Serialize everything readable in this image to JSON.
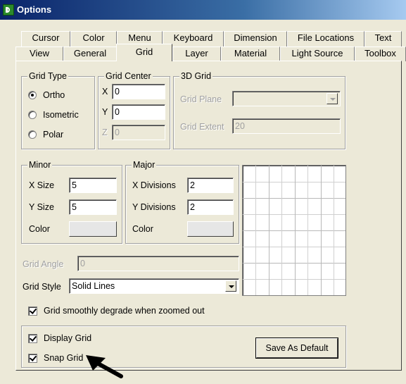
{
  "window": {
    "title": "Options"
  },
  "tabs": {
    "row_back": [
      "Cursor",
      "Color",
      "Menu",
      "Keyboard",
      "Dimension",
      "File Locations",
      "Text"
    ],
    "row_front": [
      "View",
      "General",
      "Grid",
      "Layer",
      "Material",
      "Light Source",
      "Toolbox"
    ],
    "active": "Grid"
  },
  "grid_type": {
    "legend": "Grid Type",
    "options": [
      "Ortho",
      "Isometric",
      "Polar"
    ],
    "selected": "Ortho"
  },
  "grid_center": {
    "legend": "Grid Center",
    "x_label": "X",
    "x_value": "0",
    "y_label": "Y",
    "y_value": "0",
    "z_label": "Z",
    "z_value": "0"
  },
  "grid_3d": {
    "legend": "3D Grid",
    "plane_label": "Grid Plane",
    "plane_value": "",
    "extent_label": "Grid Extent",
    "extent_value": "20"
  },
  "minor": {
    "legend": "Minor",
    "xsize_label": "X Size",
    "xsize_value": "5",
    "ysize_label": "Y Size",
    "ysize_value": "5",
    "color_label": "Color"
  },
  "major": {
    "legend": "Major",
    "xdiv_label": "X Divisions",
    "xdiv_value": "2",
    "ydiv_label": "Y Divisions",
    "ydiv_value": "2",
    "color_label": "Color"
  },
  "grid_angle": {
    "label": "Grid Angle",
    "value": "0"
  },
  "grid_style": {
    "label": "Grid Style",
    "value": "Solid Lines"
  },
  "degrade": {
    "label": "Grid smoothly degrade when zoomed out",
    "checked": true
  },
  "display_grid": {
    "label": "Display Grid",
    "checked": true
  },
  "snap_grid": {
    "label": "Snap Grid",
    "checked": true
  },
  "save_default": {
    "label": "Save As Default"
  },
  "colors": {
    "face": "#ece9d8",
    "title_start": "#0a246a",
    "title_end": "#a6caf0"
  }
}
